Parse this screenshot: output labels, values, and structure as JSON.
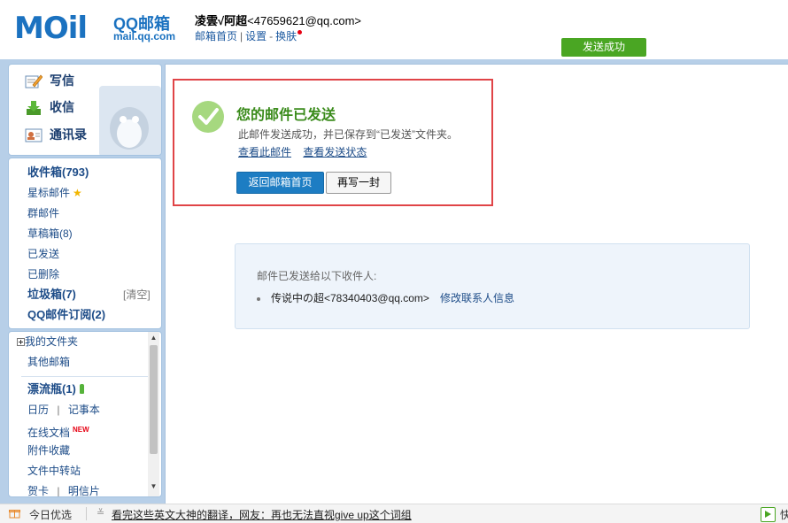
{
  "header": {
    "logo_mail": "MOil",
    "logo_qq": "QQ邮箱",
    "logo_domain": "mail.qq.com",
    "user_name": "凌雲√阿超",
    "user_email": "<47659621@qq.com>",
    "links": {
      "home": "邮箱首页",
      "settings": "设置",
      "skin": "换肤"
    },
    "sep_bar": "|",
    "sep_dash": "-",
    "status": "发送成功"
  },
  "nav": {
    "compose": "写信",
    "inbox_action": "收信",
    "contacts": "通讯录",
    "folders": {
      "inbox": "收件箱(793)",
      "starred": "星标邮件",
      "group": "群邮件",
      "drafts": "草稿箱(8)",
      "sent": "已发送",
      "deleted": "已删除",
      "spam": "垃圾箱(7)",
      "spam_clear": "[清空]",
      "subscriptions": "QQ邮件订阅(2)"
    },
    "extra": {
      "my_folders": "我的文件夹",
      "other_mailboxes": "其他邮箱",
      "drift_bottle": "漂流瓶(1)",
      "calendar": "日历",
      "sep": "|",
      "notebook": "记事本",
      "online_docs": "在线文档",
      "new_badge": "NEW",
      "attachments": "附件收藏",
      "file_transfer": "文件中转站",
      "more_left": "贺卡",
      "more_right": "明信片"
    }
  },
  "success": {
    "title": "您的邮件已发送",
    "description": "此邮件发送成功，并已保存到“已发送”文件夹。",
    "view_mail": "查看此邮件",
    "view_status": "查看发送状态",
    "return_button": "返回邮箱首页",
    "rewrite_button": "再写一封"
  },
  "recipients": {
    "title": "邮件已发送给以下收件人:",
    "items": [
      {
        "address": "传说中の超<78340403@qq.com>",
        "action": "修改联系人信息"
      }
    ]
  },
  "bottom": {
    "today": "今日优选",
    "news": "看完这些英文大神的翻译，网友：再也无法直视give up这个词组",
    "corner_text": "快"
  }
}
